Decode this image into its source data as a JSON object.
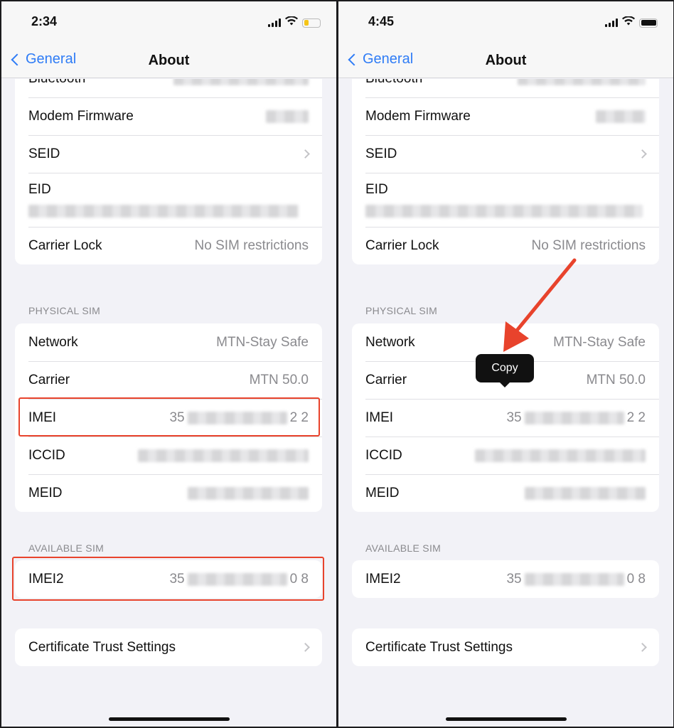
{
  "panels": [
    {
      "time": "2:34",
      "battery_color": "#f5c518",
      "battery_level": 0.3,
      "back_label": "General",
      "title": "About",
      "top_rows": [
        {
          "label": "Bluetooth",
          "blur": 190
        },
        {
          "label": "Modem Firmware",
          "blur": 60
        },
        {
          "label": "SEID",
          "chevron": true
        },
        {
          "label": "EID",
          "tall": true,
          "blur": 380
        },
        {
          "label": "Carrier Lock",
          "value": "No SIM restrictions"
        }
      ],
      "physical_header": "PHYSICAL SIM",
      "physical_rows": [
        {
          "label": "Network",
          "value": "MTN-Stay Safe"
        },
        {
          "label": "Carrier",
          "value": "MTN 50.0"
        },
        {
          "label": "IMEI",
          "prefix": "35",
          "blur": 140,
          "suffix": "2 2"
        },
        {
          "label": "ICCID",
          "blur": 240
        },
        {
          "label": "MEID",
          "blur": 170
        }
      ],
      "available_header": "AVAILABLE SIM",
      "available_rows": [
        {
          "label": "IMEI2",
          "prefix": "35",
          "blur": 140,
          "suffix": "0 8"
        }
      ],
      "cert_label": "Certificate Trust Settings",
      "highlights": true
    },
    {
      "time": "4:45",
      "battery_color": "#111111",
      "battery_level": 1,
      "back_label": "General",
      "title": "About",
      "top_rows": [
        {
          "label": "Bluetooth",
          "blur": 180
        },
        {
          "label": "Modem Firmware",
          "blur": 70
        },
        {
          "label": "SEID",
          "chevron": true
        },
        {
          "label": "EID",
          "tall": true,
          "blur": 390
        },
        {
          "label": "Carrier Lock",
          "value": "No SIM restrictions"
        }
      ],
      "physical_header": "PHYSICAL SIM",
      "physical_rows": [
        {
          "label": "Network",
          "value": "MTN-Stay Safe"
        },
        {
          "label": "Carrier",
          "value": "MTN 50.0"
        },
        {
          "label": "IMEI",
          "prefix": "35",
          "blur": 140,
          "suffix": "2 2"
        },
        {
          "label": "ICCID",
          "blur": 240
        },
        {
          "label": "MEID",
          "blur": 170
        }
      ],
      "available_header": "AVAILABLE SIM",
      "available_rows": [
        {
          "label": "IMEI2",
          "prefix": "35",
          "blur": 140,
          "suffix": "0 8"
        }
      ],
      "cert_label": "Certificate Trust Settings",
      "tooltip": "Copy",
      "arrow": true
    }
  ],
  "colors": {
    "accent": "#2f7cf6",
    "highlight": "#e8432c"
  }
}
